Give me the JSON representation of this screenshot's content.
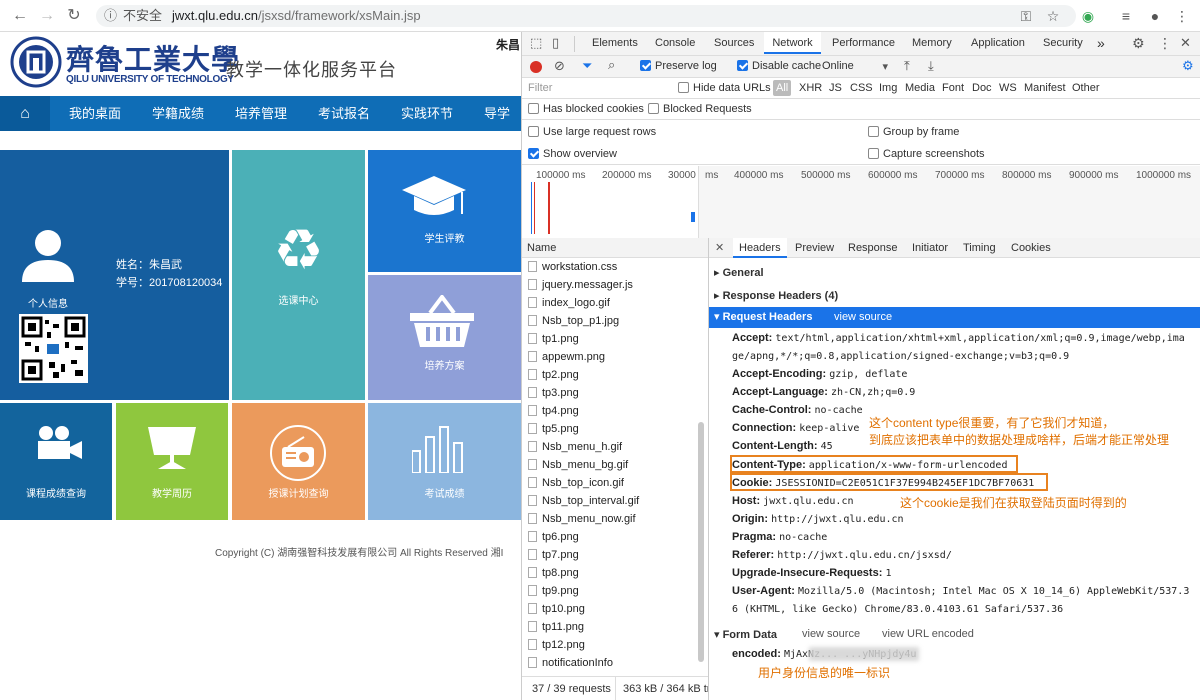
{
  "browser": {
    "insecure_label": "不安全",
    "url_host": "jwxt.qlu.edu.cn",
    "url_path": "/jsxsd/framework/xsMain.jsp"
  },
  "site": {
    "logo_chinese": "齊魯工業大學",
    "logo_english": "QILU UNIVERSITY OF TECHNOLOGY",
    "platform_title": "教学一体化服务平台",
    "user_name_top": "朱昌",
    "menu": [
      "我的桌面",
      "学籍成绩",
      "培养管理",
      "考试报名",
      "实践环节",
      "导学系"
    ],
    "profile_name": "姓名：朱昌武",
    "profile_id": "学号：201708120034",
    "tiles": {
      "personal": "个人信息",
      "course_select": "选课中心",
      "evaluation": "学生评教",
      "plan": "培养方案",
      "grades": "课程成绩查询",
      "weekly": "教学周历",
      "teaching_plan": "授课计划查询",
      "exam_scores": "考试成绩"
    },
    "footer": "Copyright (C) 湖南强智科技发展有限公司 All Rights Reserved 湘I"
  },
  "devtools": {
    "tabs": [
      "Elements",
      "Console",
      "Sources",
      "Network",
      "Performance",
      "Memory",
      "Application",
      "Security"
    ],
    "active_tab": "Network",
    "more": "»",
    "toolbar": {
      "preserve_log": "Preserve log",
      "disable_cache": "Disable cache",
      "throttle": "Online"
    },
    "filter_placeholder": "Filter",
    "hide_data_urls": "Hide data URLs",
    "filter_types": [
      "All",
      "XHR",
      "JS",
      "CSS",
      "Img",
      "Media",
      "Font",
      "Doc",
      "WS",
      "Manifest",
      "Other"
    ],
    "has_blocked_cookies": "Has blocked cookies",
    "blocked_requests": "Blocked Requests",
    "large_rows": "Use large request rows",
    "group_by_frame": "Group by frame",
    "show_overview": "Show overview",
    "capture_screenshots": "Capture screenshots",
    "timeline": [
      "100000 ms",
      "200000 ms",
      "30000",
      "ms",
      "400000 ms",
      "500000 ms",
      "600000 ms",
      "700000 ms",
      "800000 ms",
      "900000 ms",
      "1000000 ms"
    ],
    "name_header": "Name",
    "files": [
      "workstation.css",
      "jquery.messager.js",
      "index_logo.gif",
      "Nsb_top_p1.jpg",
      "tp1.png",
      "appewm.png",
      "tp2.png",
      "tp3.png",
      "tp4.png",
      "tp5.png",
      "Nsb_menu_h.gif",
      "Nsb_menu_bg.gif",
      "Nsb_top_icon.gif",
      "Nsb_top_interval.gif",
      "Nsb_menu_now.gif",
      "tp6.png",
      "tp7.png",
      "tp8.png",
      "tp9.png",
      "tp10.png",
      "tp11.png",
      "tp12.png",
      "notificationInfo"
    ],
    "status": {
      "requests": "37 / 39 requests",
      "size": "363 kB / 364 kB tr"
    },
    "detail_tabs": [
      "Headers",
      "Preview",
      "Response",
      "Initiator",
      "Timing",
      "Cookies"
    ],
    "sections": {
      "general": "General",
      "response_headers": "Response Headers (4)",
      "request_headers": "Request Headers",
      "view_source": "view source",
      "form_data": "Form Data",
      "view_url_encoded": "view URL encoded"
    },
    "headers": [
      {
        "k": "Accept:",
        "v": "text/html,application/xhtml+xml,application/xml;q=0.9,image/webp,ima"
      },
      {
        "k": "",
        "v": "ge/apng,*/*;q=0.8,application/signed-exchange;v=b3;q=0.9"
      },
      {
        "k": "Accept-Encoding:",
        "v": "gzip, deflate"
      },
      {
        "k": "Accept-Language:",
        "v": "zh-CN,zh;q=0.9"
      },
      {
        "k": "Cache-Control:",
        "v": "no-cache"
      },
      {
        "k": "Connection:",
        "v": "keep-alive"
      },
      {
        "k": "Content-Length:",
        "v": "45"
      },
      {
        "k": "Content-Type:",
        "v": "application/x-www-form-urlencoded"
      },
      {
        "k": "Cookie:",
        "v": "JSESSIONID=C2E051C1F37E994B245EF1DC7BF70631"
      },
      {
        "k": "Host:",
        "v": "jwxt.qlu.edu.cn"
      },
      {
        "k": "Origin:",
        "v": "http://jwxt.qlu.edu.cn"
      },
      {
        "k": "Pragma:",
        "v": "no-cache"
      },
      {
        "k": "Referer:",
        "v": "http://jwxt.qlu.edu.cn/jsxsd/"
      },
      {
        "k": "Upgrade-Insecure-Requests:",
        "v": "1"
      },
      {
        "k": "User-Agent:",
        "v": "Mozilla/5.0 (Macintosh; Intel Mac OS X 10_14_6) AppleWebKit/537.3"
      },
      {
        "k": "",
        "v": "6 (KHTML, like Gecko) Chrome/83.0.4103.61 Safari/537.36"
      }
    ],
    "form_encoded": {
      "k": "encoded:",
      "v": "MjAxNz... ...yNHpjdy4u"
    },
    "notes": {
      "content_type_1": "这个content type很重要，有了它我们才知道，",
      "content_type_2": "到底应该把表单中的数据处理成啥样，后端才能正常处理",
      "cookie": "这个cookie是我们在获取登陆页面时得到的",
      "encoded": "用户身份信息的唯一标识"
    }
  }
}
